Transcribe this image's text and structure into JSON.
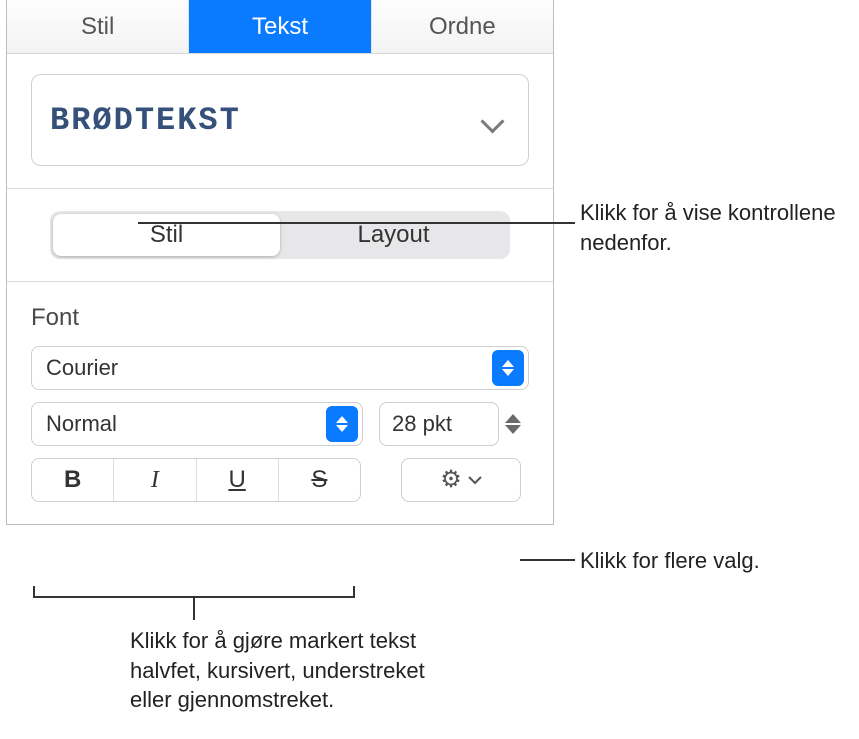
{
  "tabs": {
    "stil": "Stil",
    "tekst": "Tekst",
    "ordne": "Ordne"
  },
  "paragraph_style": "BRØDTEKST",
  "segmented": {
    "stil": "Stil",
    "layout": "Layout"
  },
  "font": {
    "label": "Font",
    "family": "Courier",
    "weight": "Normal",
    "size": "28 pkt",
    "bold_glyph": "B",
    "italic_glyph": "I",
    "underline_glyph": "U",
    "strike_glyph": "S"
  },
  "callouts": {
    "segmented": "Klikk for å vise kontrollene nedenfor.",
    "gear": "Klikk for flere valg.",
    "bius": "Klikk for å gjøre markert tekst halvfet, kursivert, understreket eller gjennomstreket."
  }
}
